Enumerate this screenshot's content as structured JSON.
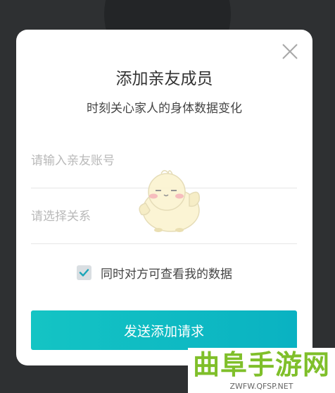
{
  "dialog": {
    "title": "添加亲友成员",
    "subtitle": "时刻关心家人的身体数据变化"
  },
  "form": {
    "account_placeholder": "请输入亲友账号",
    "relation_placeholder": "请选择关系",
    "consent_label": "同时对方可查看我的数据",
    "consent_checked": true,
    "submit_label": "发送添加请求"
  },
  "icons": {
    "close": "close-icon",
    "check": "check-icon",
    "mascot": "chick-mascot-icon"
  },
  "watermark": {
    "title": "曲阜手游网",
    "url": "ZWFW.QFSP.NET"
  },
  "colors": {
    "overlay_background": "#2e3032",
    "button_gradient_start": "#14c4c4",
    "button_gradient_end": "#0ab2c2",
    "checkbox_background": "#d9dee2",
    "check_mark": "#1aa5b8",
    "watermark_green": "#7fbf2a"
  }
}
